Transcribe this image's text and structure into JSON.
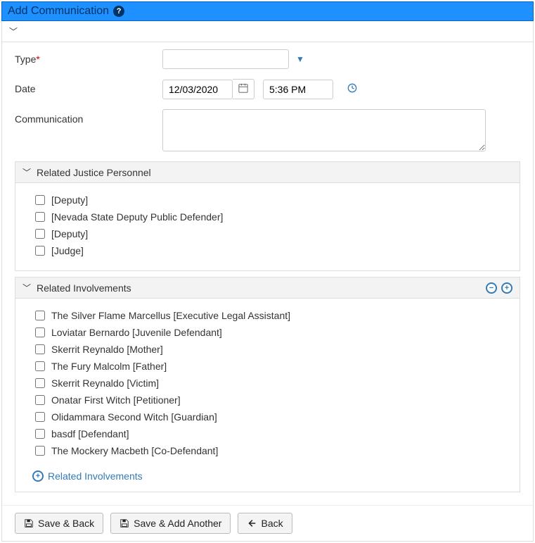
{
  "title": "Add Communication",
  "fields": {
    "type_label": "Type",
    "type_value": "",
    "date_label": "Date",
    "date_value": "12/03/2020",
    "time_value": "5:36 PM",
    "comm_label": "Communication",
    "comm_value": ""
  },
  "sections": {
    "justice": {
      "title": "Related Justice Personnel",
      "items": [
        "[Deputy]",
        "[Nevada State Deputy Public Defender]",
        "[Deputy]",
        "[Judge]"
      ]
    },
    "involvements": {
      "title": "Related Involvements",
      "items": [
        "The Silver Flame Marcellus [Executive Legal Assistant]",
        "Loviatar Bernardo [Juvenile Defendant]",
        "Skerrit Reynaldo [Mother]",
        "The Fury Malcolm [Father]",
        "Skerrit Reynaldo [Victim]",
        "Onatar First Witch [Petitioner]",
        "Olidammara Second Witch [Guardian]",
        "basdf [Defendant]",
        "The Mockery Macbeth [Co-Defendant]"
      ],
      "add_link": "Related Involvements"
    }
  },
  "buttons": {
    "save_back": "Save & Back",
    "save_another": "Save & Add Another",
    "back": "Back"
  }
}
